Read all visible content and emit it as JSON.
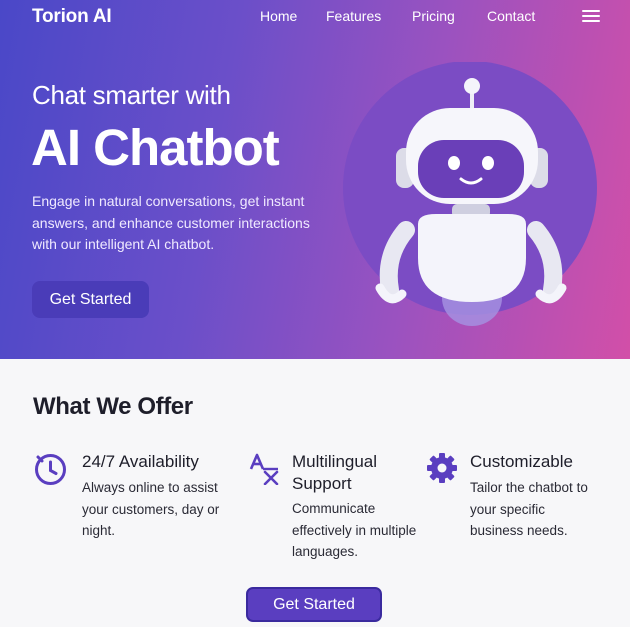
{
  "nav": {
    "brand": "Torion AI",
    "links": [
      "Home",
      "Features",
      "Pricing",
      "Contact"
    ],
    "menu_icon": "hamburger-menu-icon"
  },
  "hero": {
    "subtitle": "Chat smarter with",
    "title": "AI Chatbot",
    "description": "Engage in natural conversations, get instant answers, and enhance customer interactions with our intelligent AI chatbot.",
    "cta": "Get Started",
    "illustration": "robot-icon"
  },
  "offer": {
    "title": "What We Offer",
    "features": [
      {
        "icon": "clock-icon",
        "title": "24/7 Availability",
        "description": "Always online to assist your customers, day or night."
      },
      {
        "icon": "translate-icon",
        "title": "Multilingual Support",
        "description": "Communicate effectively in multiple languages."
      },
      {
        "icon": "gear-icon",
        "title": "Customizable",
        "description": "Tailor the chatbot to your specific business needs."
      }
    ],
    "cta": "Get Started"
  },
  "colors": {
    "gradient_start": "#4a48c8",
    "gradient_end": "#d24fa8",
    "accent": "#5a3ec0",
    "icon": "#5a3ec0"
  }
}
